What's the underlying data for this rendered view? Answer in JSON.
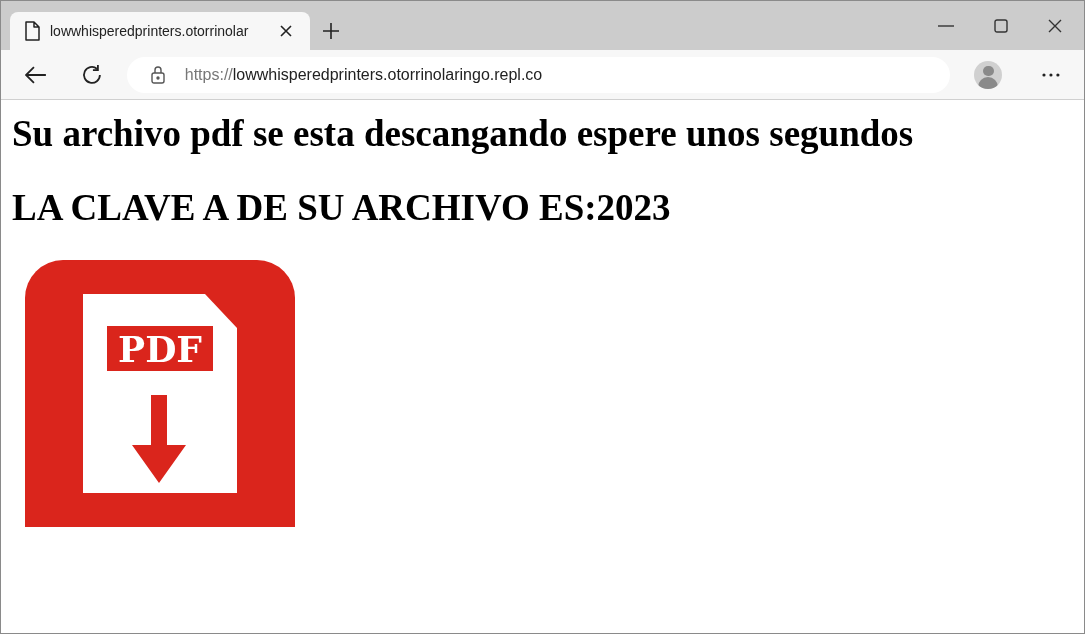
{
  "browser": {
    "tab": {
      "title": "lowwhisperedprinters.otorrinolar",
      "selected": true
    },
    "address_bar": {
      "scheme": "https://",
      "host": "lowwhisperedprinters.otorrinolaringo.repl.co"
    }
  },
  "page": {
    "headings": [
      "Su archivo pdf se esta descangando espere unos segundos",
      "LA CLAVE A DE SU ARCHIVO ES:2023"
    ],
    "pdf_graphic": {
      "label": "PDF"
    }
  }
}
